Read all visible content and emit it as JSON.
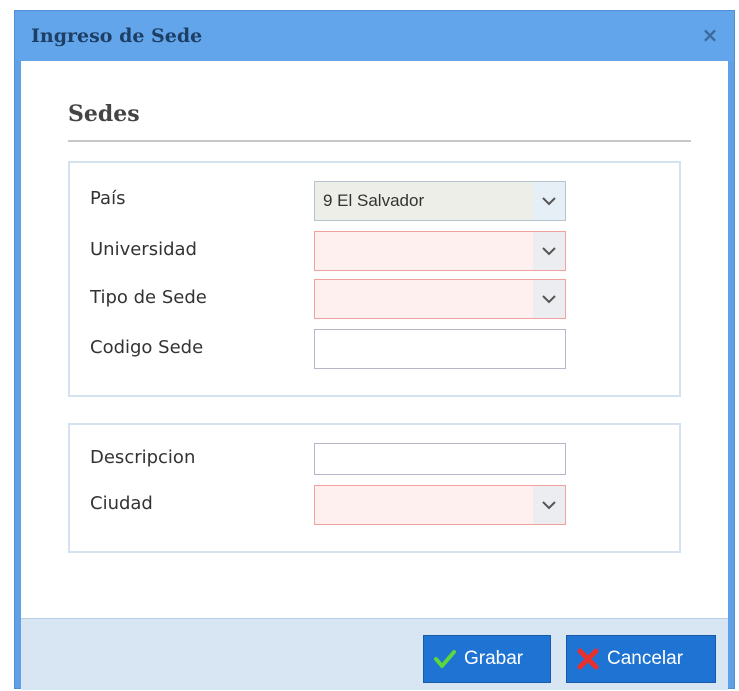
{
  "window": {
    "title": "Ingreso de Sede",
    "close_glyph": "×"
  },
  "section": {
    "title": "Sedes"
  },
  "fields": {
    "pais": {
      "label": "País",
      "value": "9 El Salvador"
    },
    "universidad": {
      "label": "Universidad",
      "value": ""
    },
    "tipo_sede": {
      "label": "Tipo de Sede",
      "value": ""
    },
    "codigo_sede": {
      "label": "Codigo Sede",
      "value": ""
    },
    "descripcion": {
      "label": "Descripcion",
      "value": ""
    },
    "ciudad": {
      "label": "Ciudad",
      "value": ""
    }
  },
  "buttons": {
    "save": {
      "label": "Grabar",
      "icon": "check-icon"
    },
    "cancel": {
      "label": "Cancelar",
      "icon": "x-icon"
    }
  },
  "colors": {
    "titlebar": "#63a5ea",
    "button": "#1f73d2",
    "required_field": "#fff0f0",
    "check": "#5fd63c",
    "cancel_x": "#e8302e"
  }
}
